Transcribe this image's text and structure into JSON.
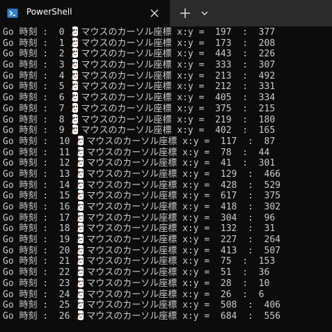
{
  "window": {
    "tab_title": "PowerShell",
    "tab_icon": "powershell-icon",
    "close_icon": "close-icon",
    "new_tab_icon": "plus-icon",
    "dropdown_icon": "chevron-down-icon"
  },
  "colors": {
    "background": "#0c0c0c",
    "titlebar": "#2b2b2b",
    "text": "#cccccc",
    "icon_blue": "#2f7fd1"
  },
  "terminal": {
    "lines": [
      {
        "before": "Go 時刻 :  0 ",
        "after": "マウスのカーソル座標 x:y =  197  :  377"
      },
      {
        "before": "Go 時刻 :  1 ",
        "after": "マウスのカーソル座標 x:y =  173  :  208"
      },
      {
        "before": "Go 時刻 :  2 ",
        "after": "マウスのカーソル座標 x:y =  443  :  226"
      },
      {
        "before": "Go 時刻 :  3 ",
        "after": "マウスのカーソル座標 x:y =  333  :  307"
      },
      {
        "before": "Go 時刻 :  4 ",
        "after": "マウスのカーソル座標 x:y =  213  :  492"
      },
      {
        "before": "Go 時刻 :  5 ",
        "after": "マウスのカーソル座標 x:y =  212  :  331"
      },
      {
        "before": "Go 時刻 :  6 ",
        "after": "マウスのカーソル座標 x:y =  405  :  334"
      },
      {
        "before": "Go 時刻 :  7 ",
        "after": "マウスのカーソル座標 x:y =  375  :  215"
      },
      {
        "before": "Go 時刻 :  8 ",
        "after": "マウスのカーソル座標 x:y =  219  :  180"
      },
      {
        "before": "Go 時刻 :  9 ",
        "after": "マウスのカーソル座標 x:y =  402  :  165"
      },
      {
        "before": "Go 時刻 :  10 ",
        "after": "マウスのカーソル座標 x:y =  117  :  87"
      },
      {
        "before": "Go 時刻 :  11 ",
        "after": "マウスのカーソル座標 x:y =  78  :  44"
      },
      {
        "before": "Go 時刻 :  12 ",
        "after": "マウスのカーソル座標 x:y =  41  :  301"
      },
      {
        "before": "Go 時刻 :  13 ",
        "after": "マウスのカーソル座標 x:y =  129  :  466"
      },
      {
        "before": "Go 時刻 :  14 ",
        "after": "マウスのカーソル座標 x:y =  428  :  529"
      },
      {
        "before": "Go 時刻 :  15 ",
        "after": "マウスのカーソル座標 x:y =  617  :  375"
      },
      {
        "before": "Go 時刻 :  16 ",
        "after": "マウスのカーソル座標 x:y =  418  :  302"
      },
      {
        "before": "Go 時刻 :  17 ",
        "after": "マウスのカーソル座標 x:y =  304  :  96"
      },
      {
        "before": "Go 時刻 :  18 ",
        "after": "マウスのカーソル座標 x:y =  132  :  31"
      },
      {
        "before": "Go 時刻 :  19 ",
        "after": "マウスのカーソル座標 x:y =  227  :  264"
      },
      {
        "before": "Go 時刻 :  20 ",
        "after": "マウスのカーソル座標 x:y =  413  :  507"
      },
      {
        "before": "Go 時刻 :  21 ",
        "after": "マウスのカーソル座標 x:y =  75  :  153"
      },
      {
        "before": "Go 時刻 :  22 ",
        "after": "マウスのカーソル座標 x:y =  51  :  36"
      },
      {
        "before": "Go 時刻 :  23 ",
        "after": "マウスのカーソル座標 x:y =  28  :  10"
      },
      {
        "before": "Go 時刻 :  24 ",
        "after": "マウスのカーソル座標 x:y =  26  :  6"
      },
      {
        "before": "Go 時刻 :  25 ",
        "after": "マウスのカーソル座標 x:y =  508  :  406"
      },
      {
        "before": "Go 時刻 :  26 ",
        "after": "マウスのカーソル座標 x:y =  684  :  556"
      }
    ],
    "line_icon": "mouse-cursor-icon"
  }
}
